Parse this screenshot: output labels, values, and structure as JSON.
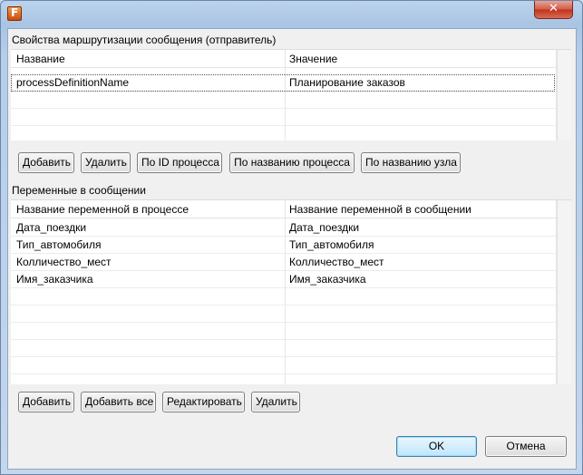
{
  "window": {
    "app_icon": "app-logo-icon",
    "close_symbol": "✕"
  },
  "routing": {
    "section_title": "Свойства маршрутизации сообщения (отправитель)",
    "columns": [
      "Название",
      "Значение"
    ],
    "rows": [
      [
        "processDefinitionName",
        "Планирование заказов"
      ]
    ],
    "buttons": {
      "add": "Добавить",
      "delete": "Удалить",
      "by_process_id": "По ID процесса",
      "by_process_name": "По названию процесса",
      "by_node_name": "По названию узла"
    }
  },
  "variables": {
    "section_title": "Переменные в сообщении",
    "columns": [
      "Название переменной в процессе",
      "Название переменной в сообщении"
    ],
    "rows": [
      [
        "Дата_поездки",
        "Дата_поездки"
      ],
      [
        "Тип_автомобиля",
        "Тип_автомобиля"
      ],
      [
        "Колличество_мест",
        "Колличество_мест"
      ],
      [
        "Имя_заказчика",
        "Имя_заказчика"
      ]
    ],
    "buttons": {
      "add": "Добавить",
      "add_all": "Добавить все",
      "edit": "Редактировать",
      "delete": "Удалить"
    }
  },
  "footer": {
    "ok": "OK",
    "cancel": "Отмена"
  }
}
